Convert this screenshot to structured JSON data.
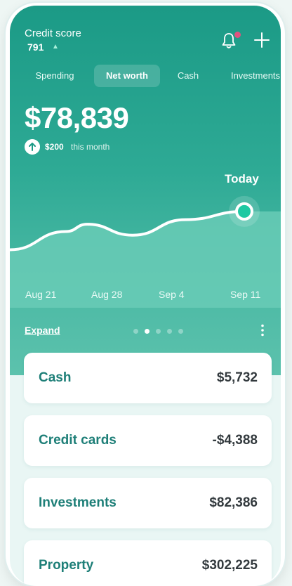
{
  "header": {
    "credit_label": "Credit score",
    "credit_value": "791",
    "credit_trend_icon": "triangle-up-icon",
    "bell_icon": "bell-icon",
    "add_icon": "plus-icon"
  },
  "tabs": [
    {
      "label": "Spending",
      "active": false
    },
    {
      "label": "Net worth",
      "active": true
    },
    {
      "label": "Cash",
      "active": false
    },
    {
      "label": "Investments",
      "active": false
    }
  ],
  "summary": {
    "amount": "$78,839",
    "delta_value": "$200",
    "delta_note": "this month"
  },
  "chart_data": {
    "type": "area",
    "marker_label": "Today",
    "x": [
      "Aug 21",
      "Aug 28",
      "Sep 4",
      "Sep 11"
    ],
    "series": [
      {
        "values": [
          25,
          45,
          53,
          41,
          58,
          67
        ]
      }
    ]
  },
  "footer": {
    "expand_label": "Expand",
    "page_dots": 5,
    "active_dot": 1,
    "more_icon": "more-vertical-icon"
  },
  "accounts": [
    {
      "label": "Cash",
      "amount": "$5,732"
    },
    {
      "label": "Credit cards",
      "amount": "-$4,388"
    },
    {
      "label": "Investments",
      "amount": "$82,386"
    },
    {
      "label": "Property",
      "amount": "$302,225"
    }
  ],
  "colors": {
    "accent": "#1b9a86",
    "notification_dot": "#e0527f"
  }
}
